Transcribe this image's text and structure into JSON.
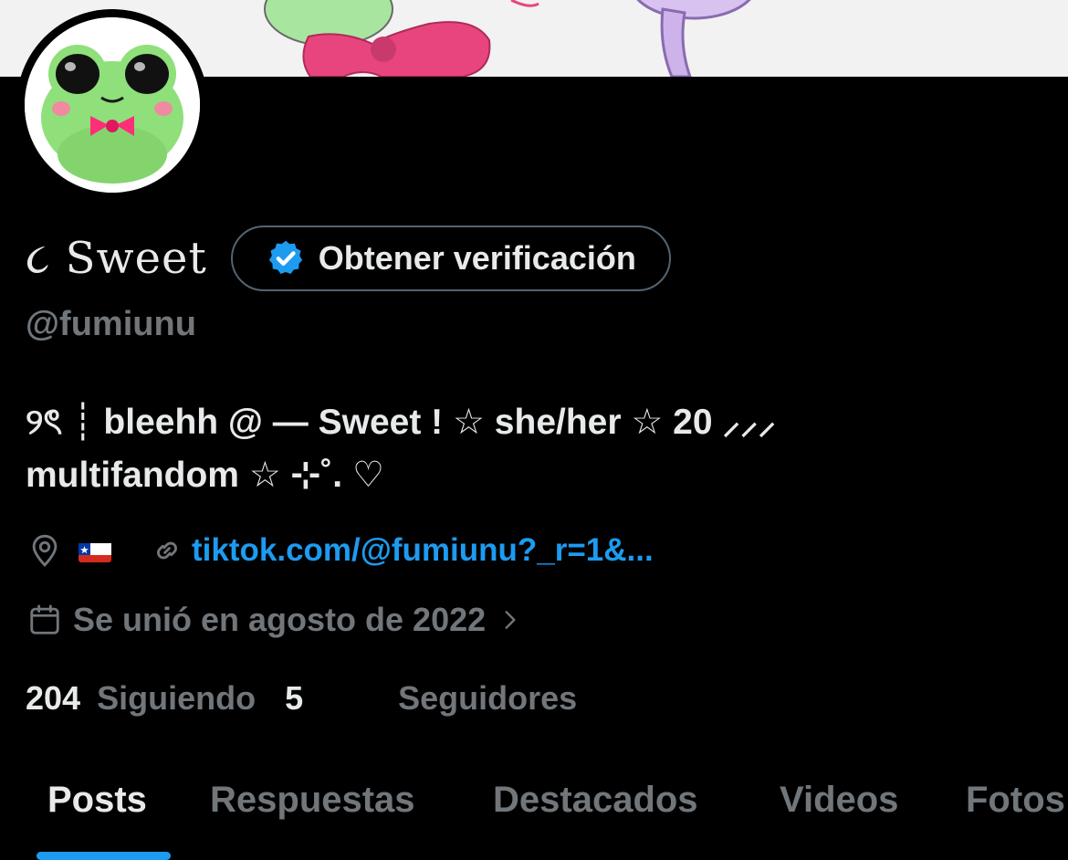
{
  "profile": {
    "display_name": "૮ Sweet",
    "handle": "@fumiunu",
    "verify_button_label": "Obtener verificación",
    "bio_line1": "୨ৎ ┊ bleehh @ — Sweet ! ☆ she/her ☆ 20 ⸝⸝⸝",
    "bio_line2": "multifandom ☆ ⊹˚. ♡",
    "location_flag": "chile-flag",
    "link_text": "tiktok.com/@fumiunu?_r=1&...",
    "joined_text": "Se unió en agosto de 2022",
    "following_count": "204",
    "following_label": "Siguiendo",
    "followers_count": "5",
    "followers_label": "Seguidores"
  },
  "tabs": [
    {
      "label": "Posts",
      "active": true
    },
    {
      "label": "Respuestas",
      "active": false
    },
    {
      "label": "Destacados",
      "active": false
    },
    {
      "label": "Videos",
      "active": false
    },
    {
      "label": "Fotos",
      "active": false
    }
  ],
  "icons": {
    "verify": "verified-badge-icon",
    "location": "location-pin-icon",
    "link": "link-icon",
    "calendar": "calendar-icon",
    "chevron": "chevron-right-icon"
  },
  "colors": {
    "background": "#000000",
    "primary_text": "#e7e9ea",
    "secondary_text": "#71767b",
    "accent": "#1d9bf0",
    "border": "#536471"
  }
}
